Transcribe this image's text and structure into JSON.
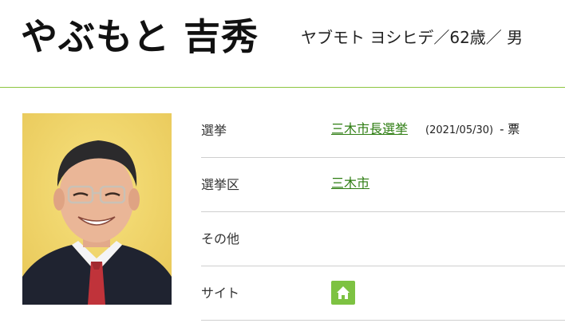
{
  "header": {
    "name": "やぶもと 吉秀",
    "kana_age_gender": "ヤブモト ヨシヒデ／62歳／ 男"
  },
  "profile_rows": [
    {
      "label": "選挙",
      "link": "三木市長選挙",
      "date": "(2021/05/30)",
      "votes": "- 票"
    },
    {
      "label": "選挙区",
      "link": "三木市"
    },
    {
      "label": "その他"
    },
    {
      "label": "サイト",
      "icon": "home-icon"
    }
  ],
  "colors": {
    "accent_green": "#8cc63f",
    "link_green": "#2e7d12",
    "icon_bg": "#7dc242",
    "photo_bg": "#f1d86a"
  }
}
